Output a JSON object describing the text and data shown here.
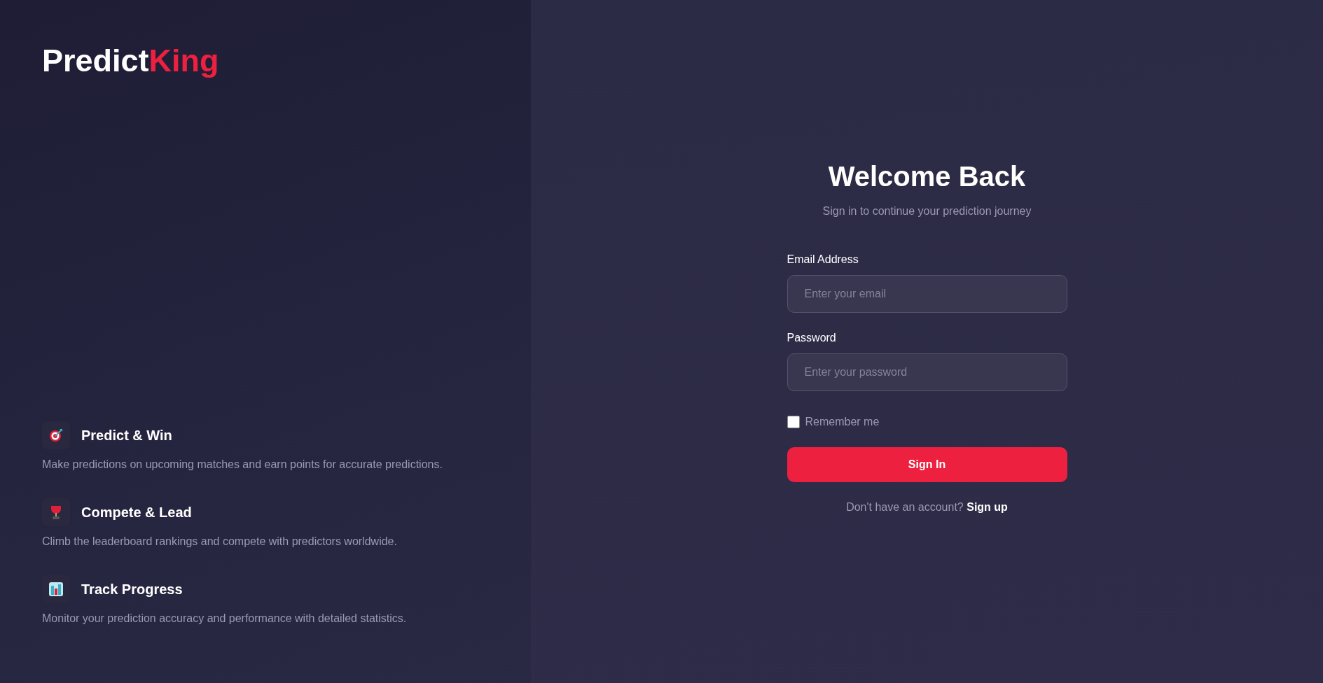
{
  "logo": [
    {
      "text": "Predict",
      "accent": false
    },
    {
      "text": "King",
      "accent": true
    }
  ],
  "features": [
    {
      "kind": "target",
      "title": "Predict & Win",
      "description": "Make predictions on upcoming matches and earn points for accurate predictions."
    },
    {
      "kind": "trophy",
      "title": "Compete & Lead",
      "description": "Climb the leaderboard rankings and compete with predictors worldwide."
    },
    {
      "kind": "chart",
      "title": "Track Progress",
      "description": "Monitor your prediction accuracy and performance with detailed statistics."
    }
  ],
  "form": {
    "title": "Welcome Back",
    "subtitle": "Sign in to continue your prediction journey",
    "fields": [
      {
        "label": "Email Address",
        "placeholder": "Enter your email"
      },
      {
        "label": "Password",
        "placeholder": "Enter your password"
      }
    ],
    "remember": {
      "label": "Remember me",
      "checked": false
    },
    "submit": "Sign In",
    "signup_prompt": "Don't have an account?",
    "signup_link": "Sign up"
  }
}
